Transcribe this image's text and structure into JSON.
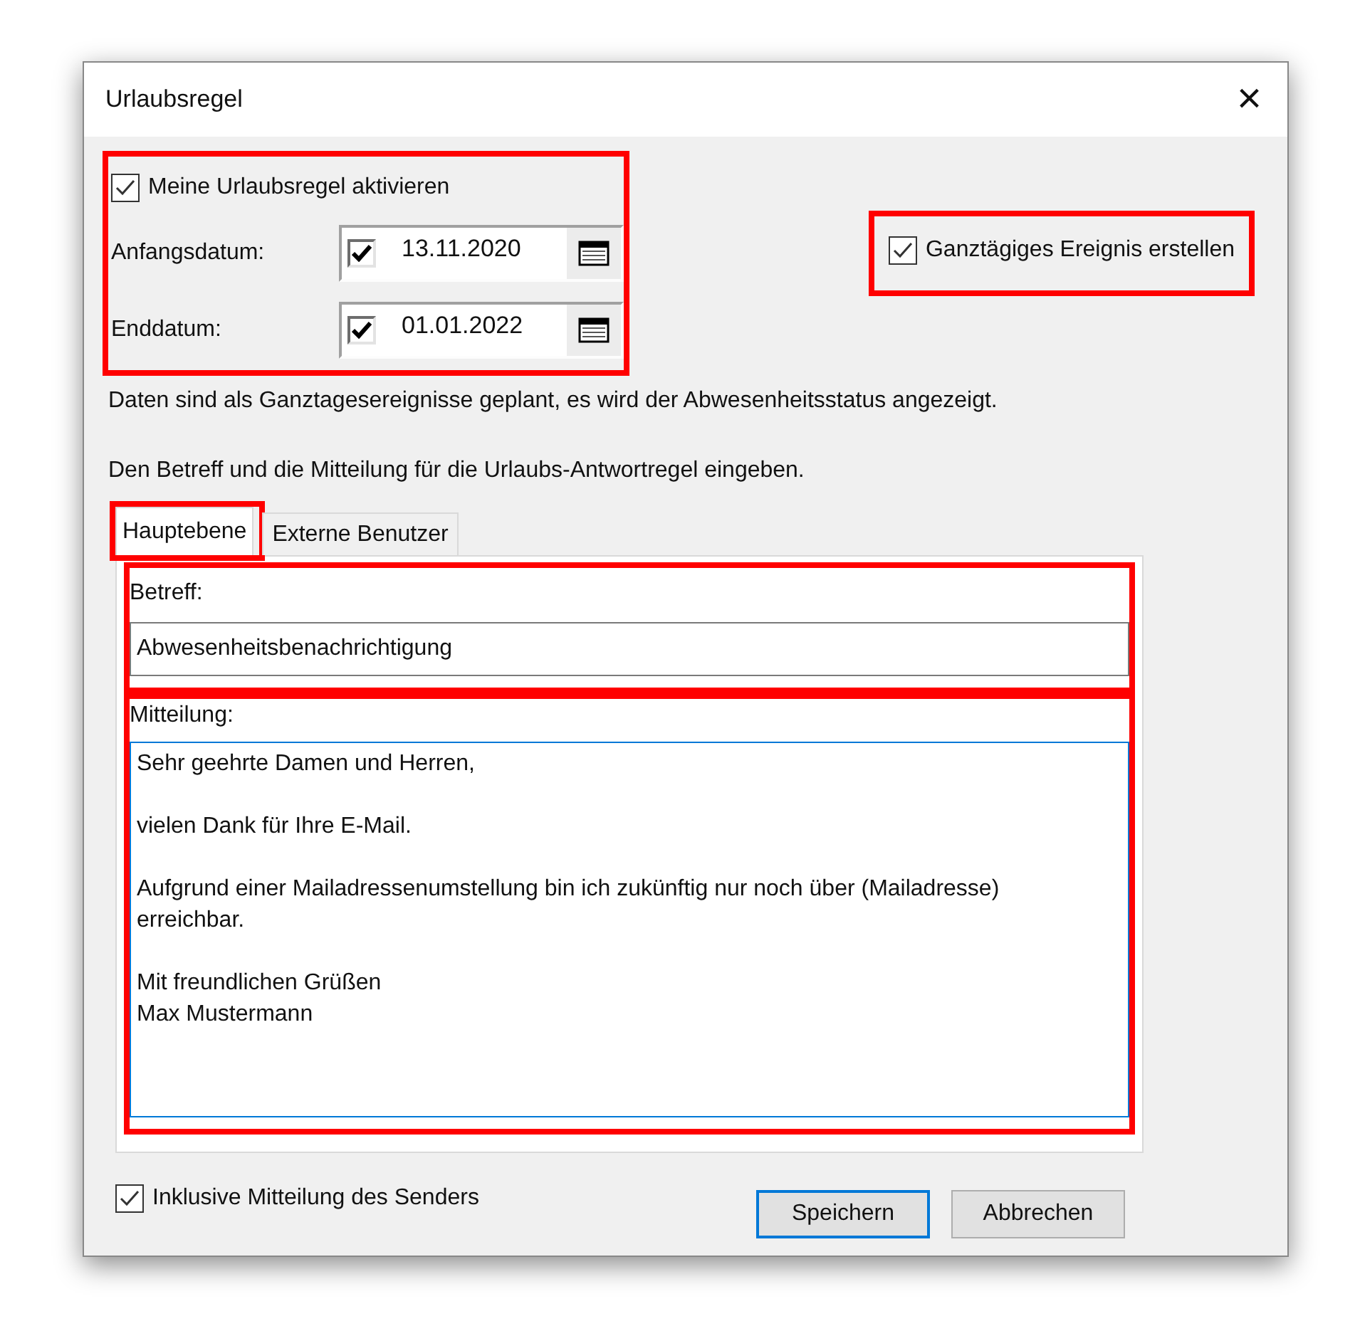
{
  "window": {
    "title": "Urlaubsregel",
    "close": "×"
  },
  "activate": {
    "label": "Meine Urlaubsregel aktivieren",
    "checked": true,
    "highlighted": true
  },
  "dates": [
    {
      "label": "Anfangsdatum:",
      "checked": true,
      "value": "13.11.2020"
    },
    {
      "label": "Enddatum:",
      "checked": true,
      "value": "01.01.2022"
    }
  ],
  "all_day": {
    "label": "Ganztägiges Ereignis erstellen",
    "checked": true,
    "highlighted": true
  },
  "info": [
    "Daten sind als Ganztagesereignisse geplant, es wird der Abwesenheitsstatus angezeigt.",
    "Den Betreff und die Mitteilung für die Urlaubs-Antwortregel eingeben."
  ],
  "tabs": [
    {
      "label": "Hauptebene",
      "selected": true,
      "highlighted": true
    },
    {
      "label": "Externe Benutzer",
      "selected": false,
      "highlighted": false
    }
  ],
  "subject": {
    "label": "Betreff:",
    "value": "Abwesenheitsbenachrichtigung",
    "highlighted": true
  },
  "message": {
    "label": "Mitteilung:",
    "value": "Sehr geehrte Damen und Herren,\n\nvielen Dank für Ihre E-Mail.\n\nAufgrund einer Mailadressenumstellung bin ich zukünftig nur noch über (Mailadresse) erreichbar.\n\nMit freundlichen Grüßen\nMax Mustermann",
    "highlighted": true
  },
  "include_sender": {
    "label": "Inklusive Mitteilung des Senders",
    "checked": true
  },
  "buttons": [
    {
      "label": "Speichern",
      "default": true
    },
    {
      "label": "Abbrechen",
      "default": false
    }
  ]
}
